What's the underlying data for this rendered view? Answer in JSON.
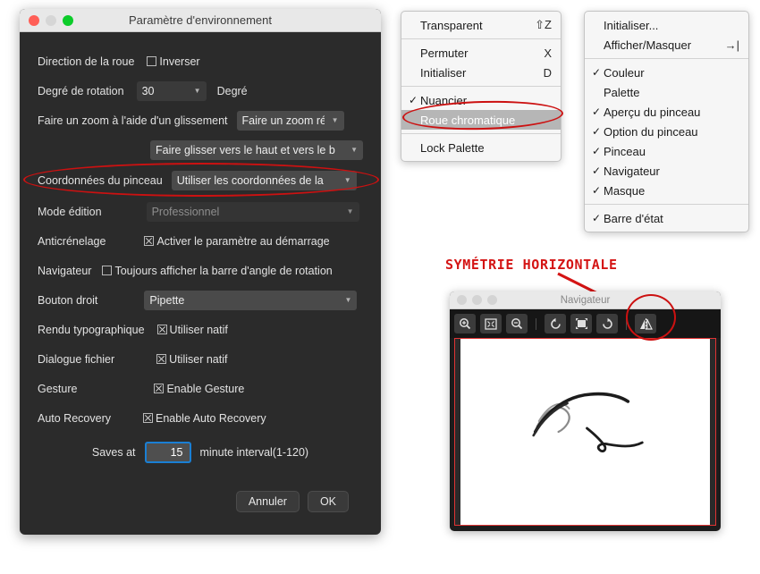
{
  "prefs_dialog": {
    "title": "Paramètre d'environnement",
    "rows": {
      "wheel_direction_label": "Direction de la roue",
      "wheel_direction_checkbox": "Inverser",
      "rotation_degree_label": "Degré de rotation",
      "rotation_degree_value": "30",
      "rotation_degree_unit": "Degré",
      "drag_zoom_label": "Faire un zoom à l'aide d'un glissement",
      "drag_zoom_value": "Faire un zoom ré",
      "drag_dir_value": "Faire glisser vers le haut et vers le b",
      "brush_coord_label": "Coordonnées du pinceau",
      "brush_coord_value": "Utiliser les coordonnées de la",
      "edit_mode_label": "Mode édition",
      "edit_mode_value": "Professionnel",
      "antialias_label": "Anticrénelage",
      "antialias_checkbox": "Activer le paramètre au démarrage",
      "navigator_label": "Navigateur",
      "navigator_checkbox": "Toujours afficher la barre d'angle de rotation",
      "right_button_label": "Bouton droit",
      "right_button_value": "Pipette",
      "text_render_label": "Rendu typographique",
      "text_render_checkbox": "Utiliser natif",
      "file_dialog_label": "Dialogue fichier",
      "file_dialog_checkbox": "Utiliser natif",
      "gesture_label": "Gesture",
      "gesture_checkbox": "Enable Gesture",
      "autorecovery_label": "Auto Recovery",
      "autorecovery_checkbox": "Enable Auto Recovery",
      "saves_at_label": "Saves at",
      "saves_at_value": "15",
      "saves_at_suffix": "minute interval(1-120)"
    },
    "buttons": {
      "cancel": "Annuler",
      "ok": "OK"
    }
  },
  "color_menu": {
    "items": [
      {
        "label": "Transparent",
        "shortcut": "⇧Z",
        "checked": false,
        "selected": false
      },
      {
        "label": "Permuter",
        "shortcut": "X",
        "checked": false,
        "selected": false
      },
      {
        "label": "Initialiser",
        "shortcut": "D",
        "checked": false,
        "selected": false
      },
      {
        "label": "Nuancier",
        "shortcut": "",
        "checked": true,
        "selected": false
      },
      {
        "label": "Roue chromatique",
        "shortcut": "",
        "checked": false,
        "selected": true
      },
      {
        "label": "Lock Palette",
        "shortcut": "",
        "checked": false,
        "selected": false
      }
    ]
  },
  "window_menu": {
    "items": [
      {
        "label": "Initialiser...",
        "shortcut": "",
        "checked": false
      },
      {
        "label": "Afficher/Masquer",
        "shortcut": "→|",
        "checked": false
      },
      {
        "label": "Couleur",
        "shortcut": "",
        "checked": true
      },
      {
        "label": "Palette",
        "shortcut": "",
        "checked": false
      },
      {
        "label": "Aperçu du pinceau",
        "shortcut": "",
        "checked": true
      },
      {
        "label": "Option du pinceau",
        "shortcut": "",
        "checked": true
      },
      {
        "label": "Pinceau",
        "shortcut": "",
        "checked": true
      },
      {
        "label": "Navigateur",
        "shortcut": "",
        "checked": true
      },
      {
        "label": "Masque",
        "shortcut": "",
        "checked": true
      },
      {
        "label": "Barre d'état",
        "shortcut": "",
        "checked": true
      }
    ]
  },
  "annotation": {
    "mirror_label": "SYMÉTRIE HORIZONTALE"
  },
  "navigator_window": {
    "title": "Navigateur",
    "toolbar": [
      "zoom-in-icon",
      "fit-screen-icon",
      "zoom-out-icon",
      "rotate-left-icon",
      "reset-rotation-icon",
      "rotate-right-icon",
      "horizontal-mirror-icon"
    ]
  },
  "colors": {
    "dialog_bg": "#2b2b2b",
    "annotation_red": "#cc1111",
    "focus_blue": "#1a7fd4",
    "menu_bg": "#f6f6f6",
    "selected_row": "#b6b6b6"
  }
}
